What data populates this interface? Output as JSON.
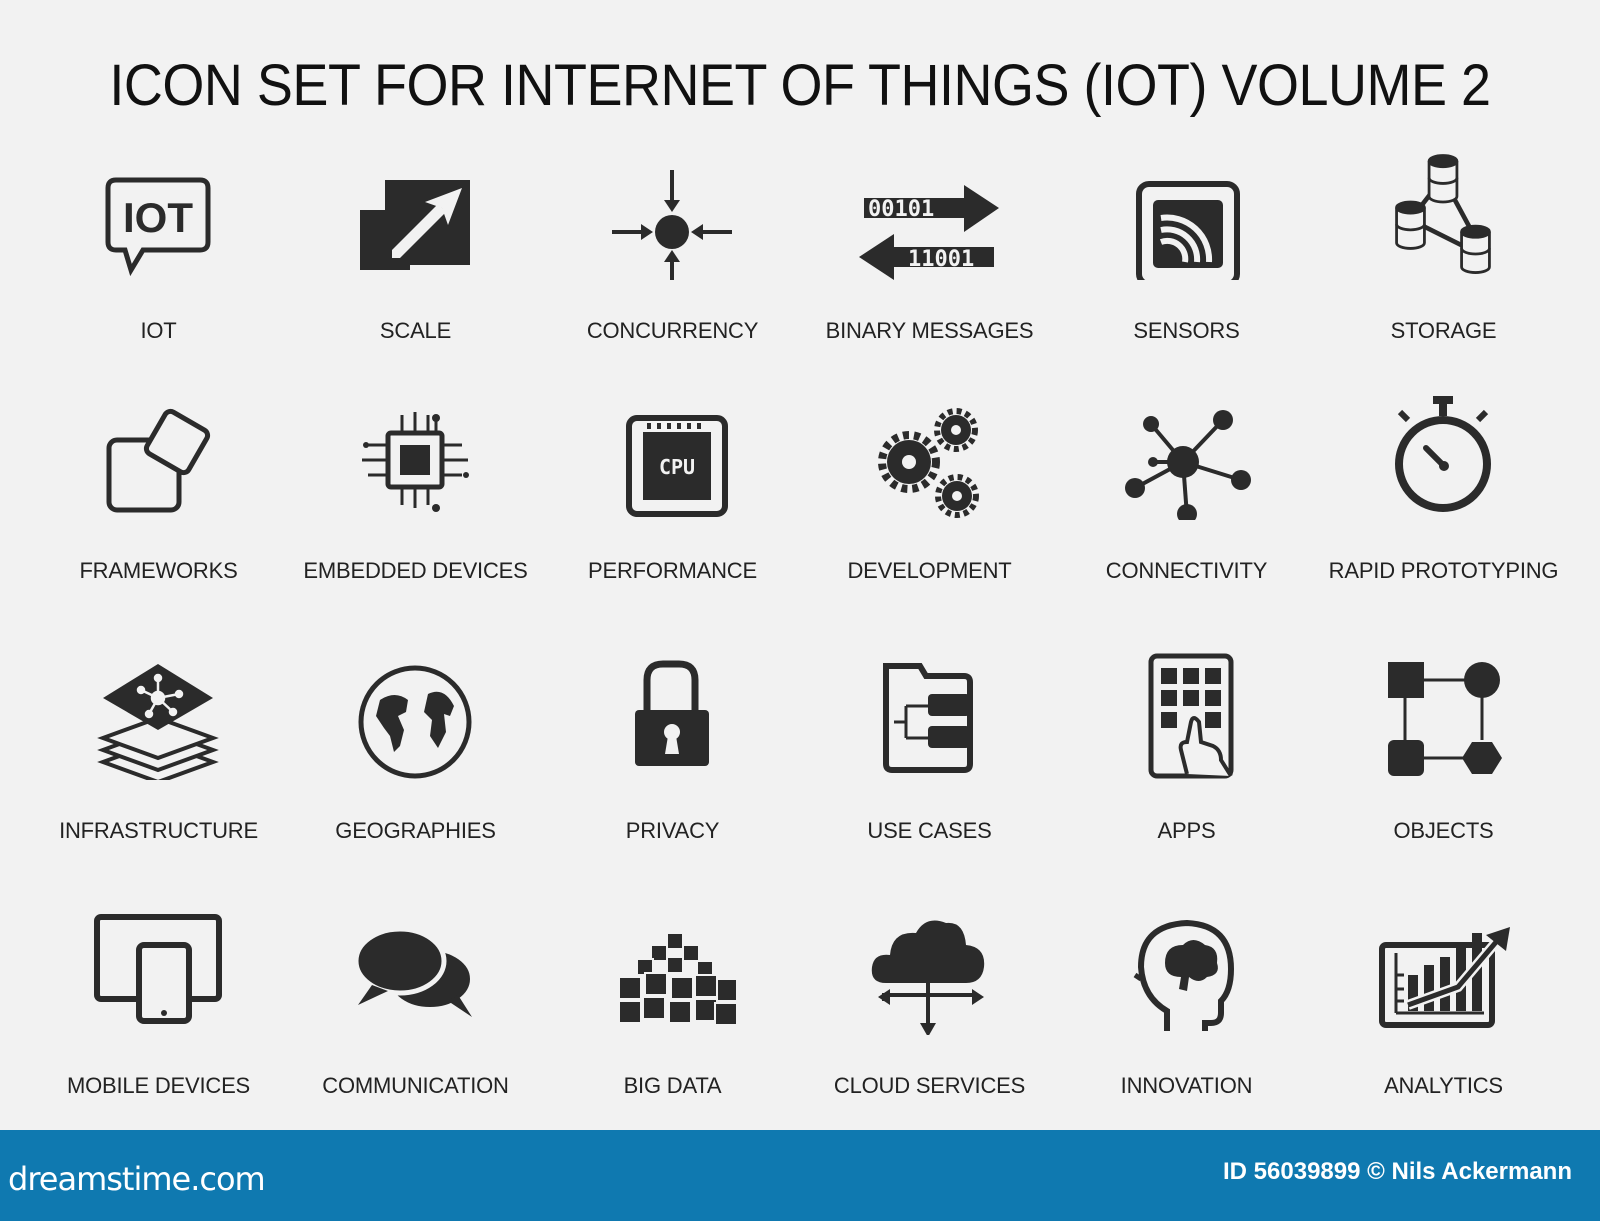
{
  "title": "ICON SET FOR INTERNET OF THINGS (IOT) VOLUME 2",
  "icons": [
    {
      "label": "IOT",
      "icon": "iot-speech-bubble-icon",
      "text": "IOT"
    },
    {
      "label": "SCALE",
      "icon": "scale-icon"
    },
    {
      "label": "CONCURRENCY",
      "icon": "concurrency-icon"
    },
    {
      "label": "BINARY MESSAGES",
      "icon": "binary-messages-icon",
      "text_a": "00101",
      "text_b": "11001"
    },
    {
      "label": "SENSORS",
      "icon": "sensors-icon"
    },
    {
      "label": "STORAGE",
      "icon": "storage-icon"
    },
    {
      "label": "FRAMEWORKS",
      "icon": "frameworks-icon"
    },
    {
      "label": "EMBEDDED DEVICES",
      "icon": "embedded-devices-icon"
    },
    {
      "label": "PERFORMANCE",
      "icon": "performance-cpu-icon",
      "text": "CPU"
    },
    {
      "label": "DEVELOPMENT",
      "icon": "development-gears-icon"
    },
    {
      "label": "CONNECTIVITY",
      "icon": "connectivity-icon"
    },
    {
      "label": "RAPID PROTOTYPING",
      "icon": "stopwatch-icon"
    },
    {
      "label": "INFRASTRUCTURE",
      "icon": "infrastructure-layers-icon"
    },
    {
      "label": "GEOGRAPHIES",
      "icon": "globe-icon"
    },
    {
      "label": "PRIVACY",
      "icon": "padlock-icon"
    },
    {
      "label": "USE CASES",
      "icon": "use-cases-folder-icon"
    },
    {
      "label": "APPS",
      "icon": "apps-touch-icon"
    },
    {
      "label": "OBJECTS",
      "icon": "objects-shapes-icon"
    },
    {
      "label": "MOBILE DEVICES",
      "icon": "mobile-devices-icon"
    },
    {
      "label": "COMMUNICATION",
      "icon": "speech-bubbles-icon"
    },
    {
      "label": "BIG DATA",
      "icon": "big-data-icon"
    },
    {
      "label": "CLOUD SERVICES",
      "icon": "cloud-services-icon"
    },
    {
      "label": "INNOVATION",
      "icon": "innovation-head-icon"
    },
    {
      "label": "ANALYTICS",
      "icon": "analytics-chart-icon"
    }
  ],
  "footer": {
    "logo": "dreamstime.com",
    "credit": "ID 56039899 © Nils Ackermann",
    "color": "#0f79b0"
  }
}
